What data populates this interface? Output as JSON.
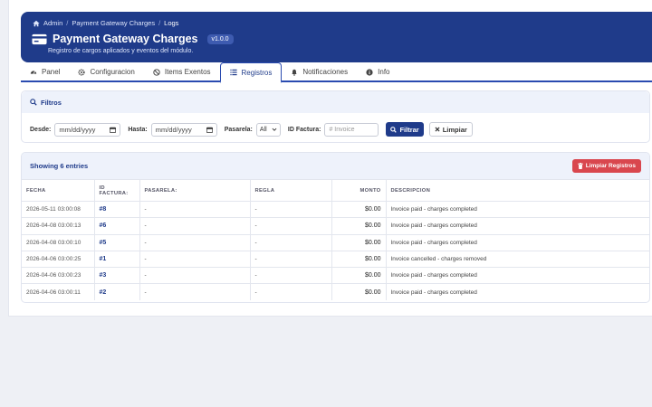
{
  "breadcrumb": {
    "items": [
      "Admin",
      "Payment Gateway Charges"
    ],
    "current": "Logs"
  },
  "header": {
    "title": "Payment Gateway Charges",
    "version": "v1.0.0",
    "subtitle": "Registro de cargos aplicados y eventos del módulo."
  },
  "tabs": [
    {
      "label": "Panel",
      "icon": "dashboard-icon"
    },
    {
      "label": "Configuracion",
      "icon": "gear-icon"
    },
    {
      "label": "Items Exentos",
      "icon": "ban-icon"
    },
    {
      "label": "Registros",
      "icon": "list-icon",
      "active": true
    },
    {
      "label": "Notificaciones",
      "icon": "bell-icon"
    },
    {
      "label": "Info",
      "icon": "info-icon"
    }
  ],
  "filters": {
    "title": "Filtros",
    "desde_label": "Desde:",
    "desde_placeholder": "mm/dd/yyyy",
    "hasta_label": "Hasta:",
    "hasta_placeholder": "mm/dd/yyyy",
    "pasarela_label": "Pasarela:",
    "pasarela_value": "All",
    "invoice_label": "ID Factura:",
    "invoice_placeholder": "# Invoice",
    "filter_button": "Filtrar",
    "clear_button": "Limpiar"
  },
  "logs": {
    "count_text": "Showing 6 entries",
    "clear_logs_button": "Limpiar Registros",
    "columns": [
      "FECHA",
      "ID FACTURA:",
      "PASARELA:",
      "REGLA",
      "MONTO",
      "DESCRIPCION"
    ],
    "rows": [
      {
        "fecha": "2026-05-11 03:00:08",
        "id": "#8",
        "pasarela": "-",
        "regla": "-",
        "monto": "$0.00",
        "descripcion": "Invoice paid - charges completed"
      },
      {
        "fecha": "2026-04-08 03:00:13",
        "id": "#6",
        "pasarela": "-",
        "regla": "-",
        "monto": "$0.00",
        "descripcion": "Invoice paid - charges completed"
      },
      {
        "fecha": "2026-04-08 03:00:10",
        "id": "#5",
        "pasarela": "-",
        "regla": "-",
        "monto": "$0.00",
        "descripcion": "Invoice paid - charges completed"
      },
      {
        "fecha": "2026-04-06 03:00:25",
        "id": "#1",
        "pasarela": "-",
        "regla": "-",
        "monto": "$0.00",
        "descripcion": "Invoice cancelled - charges removed"
      },
      {
        "fecha": "2026-04-06 03:00:23",
        "id": "#3",
        "pasarela": "-",
        "regla": "-",
        "monto": "$0.00",
        "descripcion": "Invoice paid - charges completed"
      },
      {
        "fecha": "2026-04-06 03:00:11",
        "id": "#2",
        "pasarela": "-",
        "regla": "-",
        "monto": "$0.00",
        "descripcion": "Invoice paid - charges completed"
      }
    ]
  },
  "colors": {
    "primary": "#1f3b8a",
    "danger": "#d9474e",
    "header_bg": "#1f3b8a"
  }
}
